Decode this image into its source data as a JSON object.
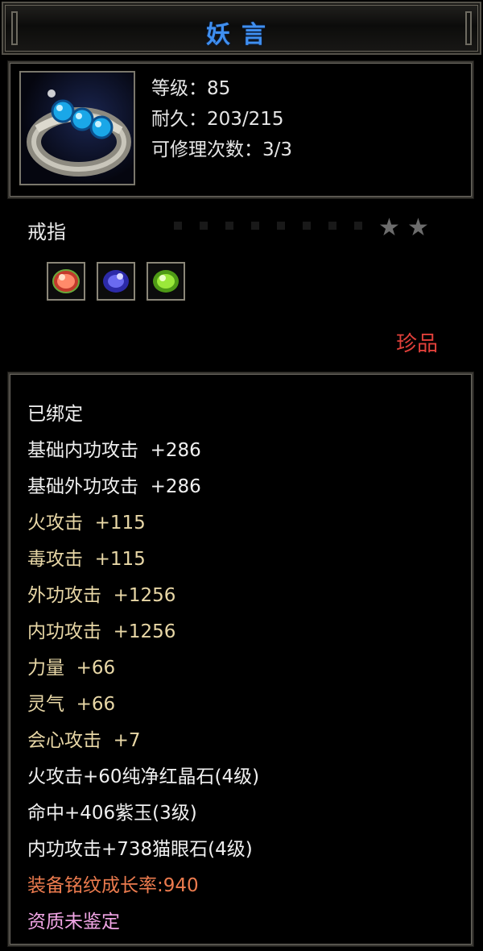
{
  "title": "妖言",
  "colors": {
    "title": "#3f8ff0",
    "rarity": "#e0403a",
    "white_text": "#f0f0f0",
    "gold_text": "#e8d7a6",
    "orange_text": "#ec7b4e",
    "pink_text": "#f2a6e6"
  },
  "item": {
    "icon": "jeweled-ring-icon",
    "level": "等级：85",
    "durability": "耐久：203/215",
    "repairs": "可修理次数：3/3",
    "type": "戒指",
    "stars": [
      "★",
      "★"
    ],
    "gems": [
      {
        "icon": "red-gem-icon",
        "color": "#e04a3a"
      },
      {
        "icon": "purple-gem-icon",
        "color": "#4a3ad0"
      },
      {
        "icon": "green-gem-icon",
        "color": "#7ad02a"
      }
    ],
    "rarity": "珍品"
  },
  "attributes": [
    {
      "text": "已绑定",
      "style": "w"
    },
    {
      "text": "基础内功攻击  +286",
      "style": "w"
    },
    {
      "text": "基础外功攻击  +286",
      "style": "w"
    },
    {
      "text": "火攻击  +115",
      "style": "y"
    },
    {
      "text": "毒攻击  +115",
      "style": "y"
    },
    {
      "text": "外功攻击  +1256",
      "style": "y"
    },
    {
      "text": "内功攻击  +1256",
      "style": "y"
    },
    {
      "text": "力量  +66",
      "style": "y"
    },
    {
      "text": "灵气  +66",
      "style": "y"
    },
    {
      "text": "会心攻击  +7",
      "style": "y"
    },
    {
      "text": "火攻击+60纯净红晶石(4级)",
      "style": "w"
    },
    {
      "text": "命中+406紫玉(3级)",
      "style": "w"
    },
    {
      "text": "内功攻击+738猫眼石(4级)",
      "style": "w"
    },
    {
      "text": "装备铭纹成长率:940",
      "style": "o"
    },
    {
      "text": "资质未鉴定",
      "style": "p"
    }
  ]
}
